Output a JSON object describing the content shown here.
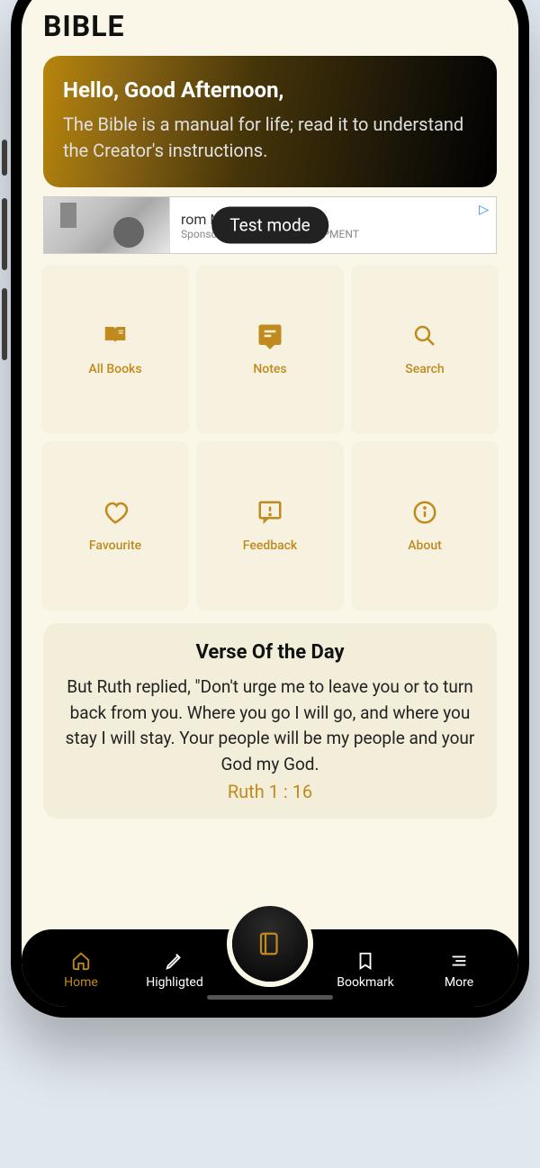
{
  "app_title": "BIBLE",
  "hero": {
    "greeting": "Hello, Good Afternoon,",
    "subtitle": "The Bible is a manual for life; read it to understand the Creator's instructions."
  },
  "ad": {
    "test_mode_label": "Test mode",
    "headline": "rom Mexico...",
    "sponsor": "Sponsored by · FITNESS EQUIPMENT"
  },
  "tiles": {
    "all_books": "All Books",
    "notes": "Notes",
    "search": "Search",
    "favourite": "Favourite",
    "feedback": "Feedback",
    "about": "About"
  },
  "verse": {
    "title": "Verse Of the Day",
    "text": "But Ruth replied, \"Don't urge me to leave you or to turn back from you. Where you go I will go, and where you stay I will stay. Your people will be my people and your God my God.",
    "reference": "Ruth 1 : 16"
  },
  "nav": {
    "home": "Home",
    "highlighted": "Highligted",
    "bookmark": "Bookmark",
    "more": "More"
  }
}
